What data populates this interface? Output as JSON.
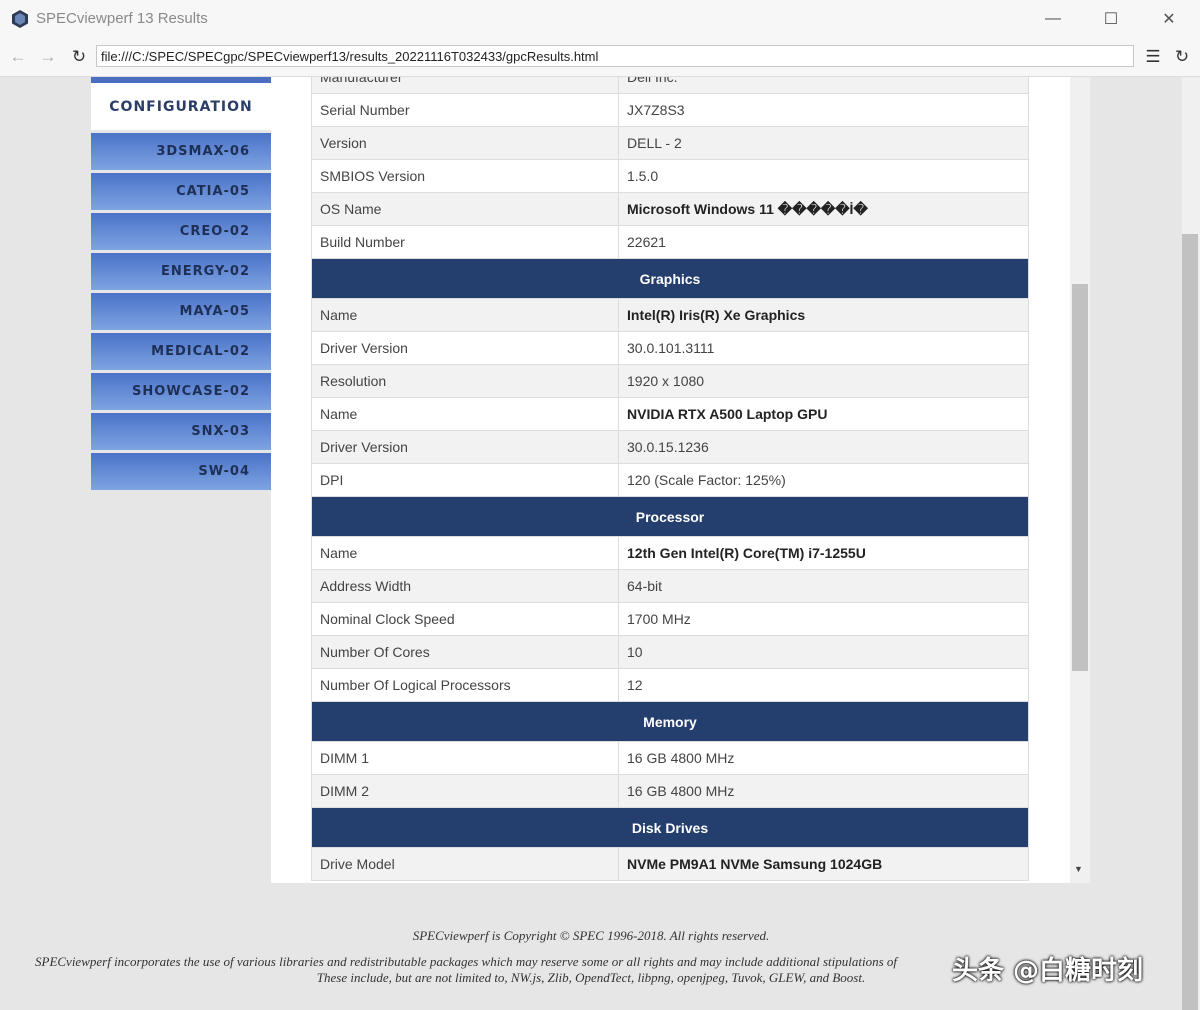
{
  "window": {
    "title": "SPECviewperf 13 Results"
  },
  "address_bar": {
    "url": "file:///C:/SPEC/SPECgpc/SPECviewperf13/results_20221116T032433/gpcResults.html"
  },
  "sidebar": {
    "active": "CONFIGURATION",
    "items": [
      "3DSMAX-06",
      "CATIA-05",
      "CREO-02",
      "ENERGY-02",
      "MAYA-05",
      "MEDICAL-02",
      "SHOWCASE-02",
      "SNX-03",
      "SW-04"
    ]
  },
  "table": {
    "partial_row": {
      "key": "Manufacturer",
      "value": "Dell Inc."
    },
    "system_rows": [
      {
        "key": "Serial Number",
        "value": "JX7Z8S3"
      },
      {
        "key": "Version",
        "value": "DELL - 2"
      },
      {
        "key": "SMBIOS Version",
        "value": "1.5.0"
      },
      {
        "key": "OS Name",
        "value": "Microsoft Windows 11 �����İ�"
      },
      {
        "key": "Build Number",
        "value": "22621"
      }
    ],
    "graphics_header": "Graphics",
    "graphics_rows": [
      {
        "key": "Name",
        "value": "Intel(R) Iris(R) Xe Graphics"
      },
      {
        "key": "Driver Version",
        "value": "30.0.101.3111"
      },
      {
        "key": "Resolution",
        "value": "1920 x 1080"
      },
      {
        "key": "Name",
        "value": "NVIDIA RTX A500 Laptop GPU"
      },
      {
        "key": "Driver Version",
        "value": "30.0.15.1236"
      },
      {
        "key": "DPI",
        "value": "120 (Scale Factor: 125%)"
      }
    ],
    "processor_header": "Processor",
    "processor_rows": [
      {
        "key": "Name",
        "value": "12th Gen Intel(R) Core(TM) i7-1255U"
      },
      {
        "key": "Address Width",
        "value": "64-bit"
      },
      {
        "key": "Nominal Clock Speed",
        "value": "1700 MHz"
      },
      {
        "key": "Number Of Cores",
        "value": "10"
      },
      {
        "key": "Number Of Logical Processors",
        "value": "12"
      }
    ],
    "memory_header": "Memory",
    "memory_rows": [
      {
        "key": "DIMM 1",
        "value": "16 GB 4800 MHz"
      },
      {
        "key": "DIMM 2",
        "value": "16 GB 4800 MHz"
      }
    ],
    "disk_header": "Disk Drives",
    "disk_rows": [
      {
        "key": "Drive Model",
        "value": "NVMe PM9A1 NVMe Samsung 1024GB"
      }
    ]
  },
  "footer": {
    "copyright": "SPECviewperf is Copyright © SPEC 1996-2018. All rights reserved.",
    "libraries": "SPECviewperf incorporates the use of various libraries and redistributable packages which may reserve some or all rights and may include additional stipulations of",
    "includes": "These include, but are not limited to, NW.js, Zlib, OpendTect, libpng, openjpeg, Tuvok, GLEW, and Boost."
  },
  "watermark": "头条 @白糖时刻"
}
